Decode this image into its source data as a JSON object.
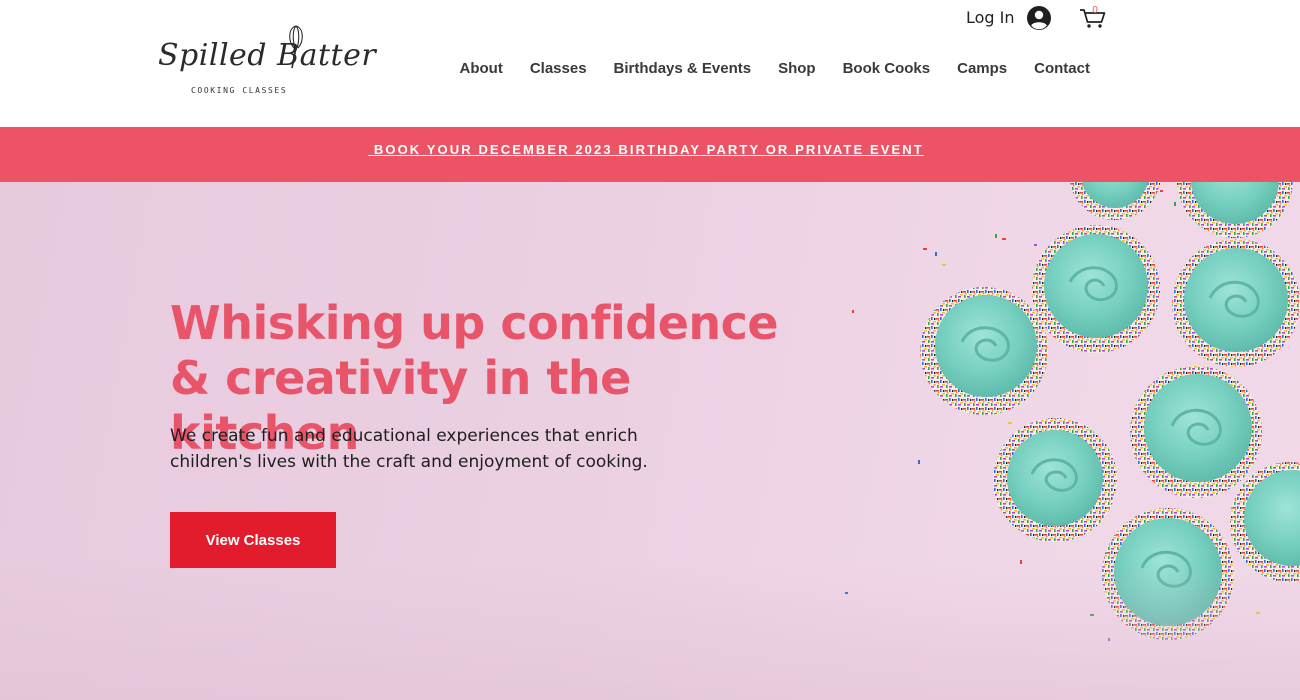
{
  "header": {
    "logo": {
      "name": "Spilled Batter",
      "tagline": "COOKING CLASSES"
    },
    "login_label": "Log In",
    "cart_count": "0",
    "nav": [
      {
        "label": "About"
      },
      {
        "label": "Classes"
      },
      {
        "label": "Birthdays & Events"
      },
      {
        "label": "Shop"
      },
      {
        "label": "Book Cooks"
      },
      {
        "label": "Camps"
      },
      {
        "label": "Contact"
      }
    ]
  },
  "announcement": {
    "link_text": " BOOK YOUR DECEMBER 2023 BIRTHDAY PARTY OR PRIVATE EVENT"
  },
  "hero": {
    "title": "Whisking up confidence & creativity in the kitchen",
    "description": "We create fun and educational experiences that enrich children's lives with the craft and enjoyment of cooking.",
    "button_label": "View Classes"
  },
  "colors": {
    "accent": "#e8556a",
    "banner": "#ec5466",
    "button": "#e31c2d",
    "frosting": "#7fd3c4",
    "background_pink": "#ecd2e3"
  },
  "icons": {
    "user": "user-avatar-icon",
    "cart": "shopping-cart-icon",
    "logo_whisk": "whisk-icon"
  }
}
